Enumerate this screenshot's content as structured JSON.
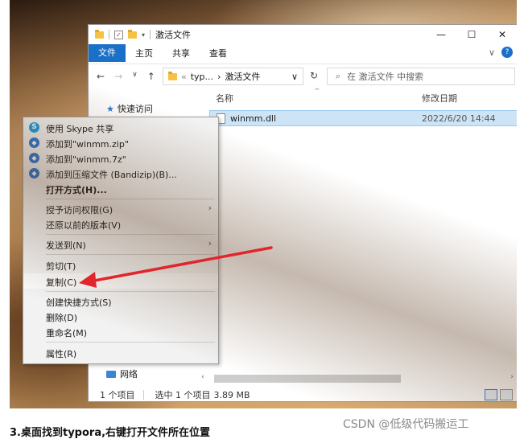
{
  "window": {
    "title": "激活文件",
    "controls": [
      "—",
      "☐",
      "✕"
    ]
  },
  "ribbon": {
    "file": "文件",
    "tabs": [
      "主页",
      "共享",
      "查看"
    ]
  },
  "address": {
    "path_short": "typ...",
    "path_sep": "›",
    "path_current": "激活文件",
    "search_placeholder": "在 激活文件 中搜索"
  },
  "columns": {
    "name": "名称",
    "date": "修改日期"
  },
  "files": [
    {
      "name": "winmm.dll",
      "date": "2022/6/20 14:44"
    }
  ],
  "sidebar": {
    "quick_access": "快速访问",
    "network": "网络"
  },
  "status": {
    "count": "1 个项目",
    "selected": "选中 1 个项目",
    "size": "3.89 MB"
  },
  "context_menu": {
    "items": [
      {
        "label": "使用 Skype 共享",
        "icon": "skype-icon"
      },
      {
        "label": "添加到\"winmm.zip\"",
        "icon": "bandizip-icon"
      },
      {
        "label": "添加到\"winmm.7z\"",
        "icon": "bandizip-icon"
      },
      {
        "label": "添加到压缩文件 (Bandizip)(B)...",
        "icon": "bandizip-icon"
      },
      {
        "label": "打开方式(H)..."
      },
      {
        "label": "授予访问权限(G)"
      },
      {
        "label": "还原以前的版本(V)"
      },
      {
        "label": "发送到(N)"
      },
      {
        "label": "剪切(T)"
      },
      {
        "label": "复制(C)"
      },
      {
        "label": "创建快捷方式(S)"
      },
      {
        "label": "删除(D)"
      },
      {
        "label": "重命名(M)"
      },
      {
        "label": "属性(R)"
      }
    ]
  },
  "annotation": {
    "arrow_color": "#e0262c"
  },
  "caption": "3.桌面找到typora,右键打开文件所在位置",
  "watermark": "CSDN @低级代码搬运工"
}
